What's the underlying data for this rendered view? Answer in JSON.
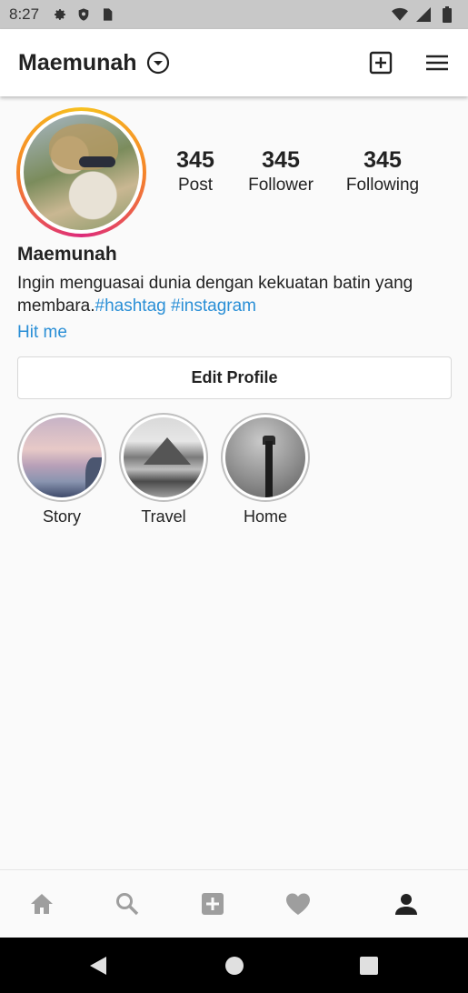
{
  "status": {
    "time": "8:27",
    "icons": [
      "gear-icon",
      "shield-icon",
      "sim-card-icon",
      "wifi-icon",
      "signal-icon",
      "battery-icon"
    ]
  },
  "app_bar": {
    "title": "Maemunah",
    "icons": [
      "chevron-down-circle-icon",
      "add-box-icon",
      "menu-icon"
    ]
  },
  "profile": {
    "username": "Maemunah",
    "bio_text": "Ingin menguasai dunia dengan kekuatan batin yang membara.",
    "hashtags": [
      "#hashtag",
      "#instagram"
    ],
    "link": "Hit me",
    "stats": [
      {
        "value": "345",
        "label": "Post"
      },
      {
        "value": "345",
        "label": "Follower"
      },
      {
        "value": "345",
        "label": "Following"
      }
    ],
    "edit_button": "Edit Profile"
  },
  "highlights": [
    {
      "label": "Story"
    },
    {
      "label": "Travel"
    },
    {
      "label": "Home"
    }
  ],
  "bottom_nav": {
    "items": [
      "home-icon",
      "search-icon",
      "add-icon",
      "heart-icon",
      "profile-icon"
    ],
    "active": "profile-icon"
  },
  "colors": {
    "accent_link": "#2a8fd6",
    "ring_gradient_start": "#f58529",
    "ring_gradient_end": "#f7c11f",
    "nav_inactive": "#9e9e9e",
    "nav_active": "#222222"
  }
}
